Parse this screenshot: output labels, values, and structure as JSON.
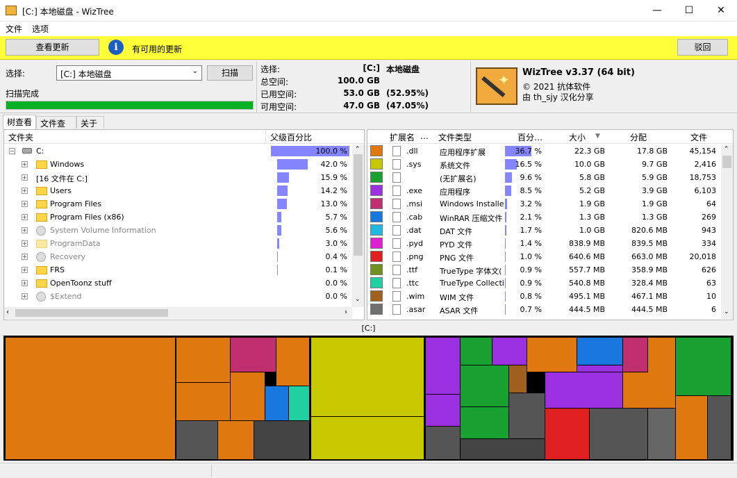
{
  "window": {
    "title": "[C:] 本地磁盘  - WizTree",
    "minimize": "—",
    "maximize": "☐",
    "close": "✕"
  },
  "menu": [
    "文件",
    "选项"
  ],
  "update": {
    "check_label": "查看更新",
    "message": "有可用的更新",
    "info_icon": "i",
    "dismiss_label": "驳回"
  },
  "select": {
    "label": "选择:",
    "drive_value": "[C:] 本地磁盘",
    "scan_label": "扫描",
    "status": "扫描完成",
    "progress_pct": 100
  },
  "summary": {
    "select_label": "选择:",
    "select_value": "[C:]",
    "select_name": "本地磁盘",
    "total_label": "总空间:",
    "total_value": "100.0 GB",
    "used_label": "已用空间:",
    "used_value": "53.0 GB",
    "used_pct": "(52.95%)",
    "free_label": "可用空间:",
    "free_value": "47.0 GB",
    "free_pct": "(47.05%)"
  },
  "about": {
    "name": "WizTree v3.37 (64 bit)",
    "copyright": "© 2021 抗体软件",
    "credit": "由 th_sjy 汉化分享"
  },
  "tabs": [
    "树查看",
    "文件查看",
    "关于"
  ],
  "tree": {
    "col_folder": "文件夹",
    "col_parent_pct": "父级百分比",
    "root": {
      "name": "C:",
      "pct": "100.0 %",
      "fraction": 1.0
    },
    "rows": [
      {
        "name": "Windows",
        "pct": "42.0 %",
        "fraction": 0.42,
        "kind": "folder"
      },
      {
        "name": "[16 文件在       C:]",
        "pct": "15.9 %",
        "fraction": 0.159,
        "kind": "files"
      },
      {
        "name": "Users",
        "pct": "14.2 %",
        "fraction": 0.142,
        "kind": "folder"
      },
      {
        "name": "Program Files",
        "pct": "13.0 %",
        "fraction": 0.13,
        "kind": "folder"
      },
      {
        "name": "Program Files (x86)",
        "pct": "5.7 %",
        "fraction": 0.057,
        "kind": "folder"
      },
      {
        "name": "System Volume Information",
        "pct": "5.6 %",
        "fraction": 0.056,
        "kind": "system"
      },
      {
        "name": "ProgramData",
        "pct": "3.0 %",
        "fraction": 0.03,
        "kind": "hidden"
      },
      {
        "name": "Recovery",
        "pct": "0.4 %",
        "fraction": 0.004,
        "kind": "system"
      },
      {
        "name": "FRS",
        "pct": "0.1 %",
        "fraction": 0.001,
        "kind": "folder"
      },
      {
        "name": "OpenToonz stuff",
        "pct": "0.0 %",
        "fraction": 0.0,
        "kind": "folder"
      },
      {
        "name": "$Extend",
        "pct": "0.0 %",
        "fraction": 0.0,
        "kind": "system"
      }
    ]
  },
  "ext": {
    "headers": {
      "ext": "扩展名",
      "more": "…",
      "type": "文件类型",
      "pct": "百分…",
      "size": "大小",
      "alloc": "分配",
      "files": "文件"
    },
    "rows": [
      {
        "color": "#e07810",
        "ext": ".dll",
        "type": "应用程序扩展",
        "pct": "36.7 %",
        "fraction": 0.367,
        "size": "22.3 GB",
        "alloc": "17.8 GB",
        "files": "45,154"
      },
      {
        "color": "#c8c800",
        "ext": ".sys",
        "type": "系统文件",
        "pct": "16.5 %",
        "fraction": 0.165,
        "size": "10.0 GB",
        "alloc": "9.7 GB",
        "files": "2,416"
      },
      {
        "color": "#18a030",
        "ext": "",
        "type": "(无扩展名)",
        "pct": "9.6 %",
        "fraction": 0.096,
        "size": "5.8 GB",
        "alloc": "5.9 GB",
        "files": "18,753"
      },
      {
        "color": "#9a30e0",
        "ext": ".exe",
        "type": "应用程序",
        "pct": "8.5 %",
        "fraction": 0.085,
        "size": "5.2 GB",
        "alloc": "3.9 GB",
        "files": "6,103"
      },
      {
        "color": "#c03070",
        "ext": ".msi",
        "type": "Windows Installer",
        "pct": "3.2 %",
        "fraction": 0.032,
        "size": "1.9 GB",
        "alloc": "1.9 GB",
        "files": "64"
      },
      {
        "color": "#1878e0",
        "ext": ".cab",
        "type": "WinRAR 压缩文件",
        "pct": "2.1 %",
        "fraction": 0.021,
        "size": "1.3 GB",
        "alloc": "1.3 GB",
        "files": "269"
      },
      {
        "color": "#20b8e0",
        "ext": ".dat",
        "type": "DAT 文件",
        "pct": "1.7 %",
        "fraction": 0.017,
        "size": "1.0 GB",
        "alloc": "820.6 MB",
        "files": "943"
      },
      {
        "color": "#e020d0",
        "ext": ".pyd",
        "type": "PYD 文件",
        "pct": "1.4 %",
        "fraction": 0.014,
        "size": "838.9 MB",
        "alloc": "839.5 MB",
        "files": "334"
      },
      {
        "color": "#e02020",
        "ext": ".png",
        "type": "PNG 文件",
        "pct": "1.0 %",
        "fraction": 0.01,
        "size": "640.6 MB",
        "alloc": "663.0 MB",
        "files": "20,018"
      },
      {
        "color": "#709020",
        "ext": ".ttf",
        "type": "TrueType 字体文(",
        "pct": "0.9 %",
        "fraction": 0.009,
        "size": "557.7 MB",
        "alloc": "358.9 MB",
        "files": "626"
      },
      {
        "color": "#20d0a0",
        "ext": ".ttc",
        "type": "TrueType Collectio",
        "pct": "0.9 %",
        "fraction": 0.009,
        "size": "540.8 MB",
        "alloc": "328.4 MB",
        "files": "63"
      },
      {
        "color": "#a06020",
        "ext": ".wim",
        "type": "WIM 文件",
        "pct": "0.8 %",
        "fraction": 0.008,
        "size": "495.1 MB",
        "alloc": "467.1 MB",
        "files": "10"
      },
      {
        "color": "#707070",
        "ext": ".asar",
        "type": "ASAR 文件",
        "pct": "0.7 %",
        "fraction": 0.007,
        "size": "444.5 MB",
        "alloc": "444.5 MB",
        "files": "6"
      }
    ]
  },
  "treemap": {
    "label": "[C:]"
  },
  "icons": {
    "drive": "drive-icon",
    "folder": "folder-icon",
    "system": "gear-icon"
  }
}
